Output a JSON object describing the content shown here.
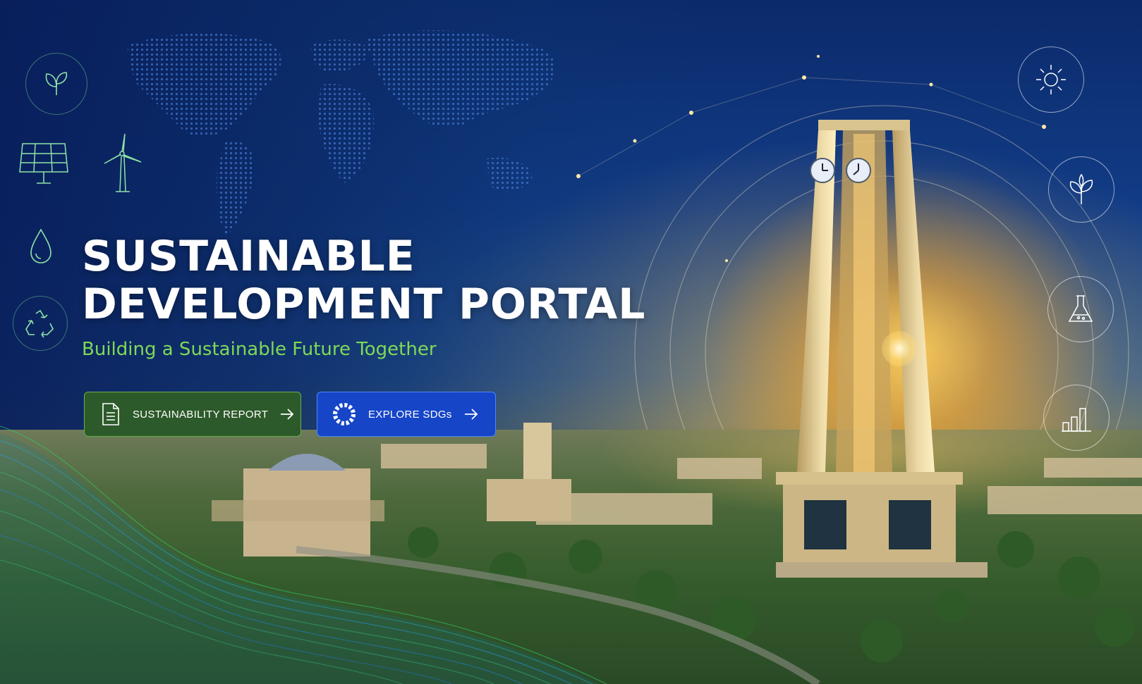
{
  "hero": {
    "title_line1": "SUSTAINABLE",
    "title_line2": "DEVELOPMENT PORTAL",
    "tagline": "Building a Sustainable Future Together"
  },
  "buttons": {
    "report_label": "SUSTAINABILITY REPORT",
    "sdg_label": "EXPLORE SDGs"
  },
  "icons": {
    "left": [
      "leaf-icon",
      "solar-panel-icon",
      "wind-turbine-icon",
      "water-drop-icon",
      "recycle-icon"
    ],
    "right": [
      "sun-icon",
      "plant-icon",
      "flask-icon",
      "bar-chart-icon"
    ]
  },
  "colors": {
    "brand_blue": "#1645c8",
    "brand_green": "#2d5a2a",
    "tagline_green": "#7ed957",
    "sky_dark": "#0b2a6b"
  }
}
